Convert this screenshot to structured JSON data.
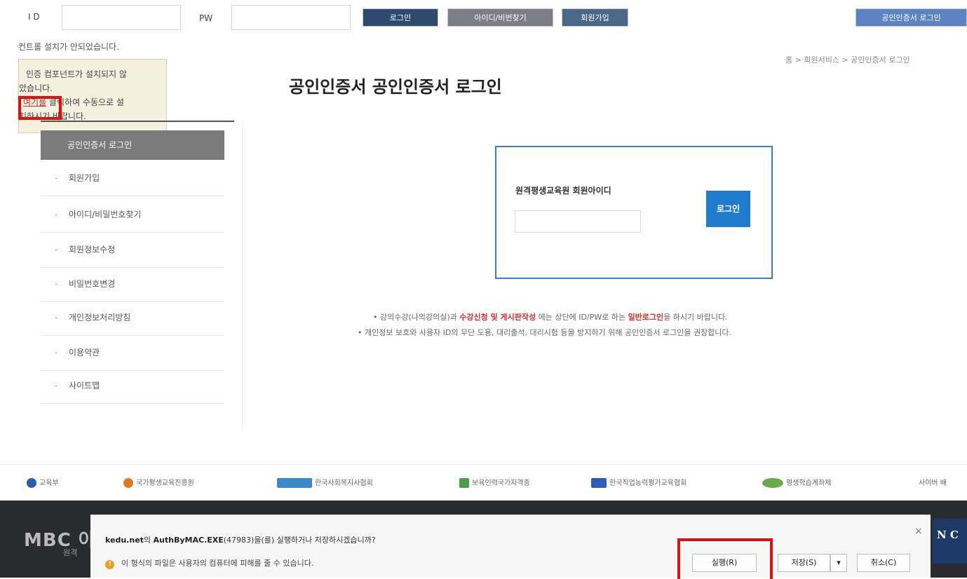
{
  "topbar": {
    "id_label": "I D",
    "pw_label": "PW",
    "login_button": "로그인",
    "find_button": "아이디/비번찾기",
    "join_button": "회원가입",
    "cert_login_button": "공인인증서 로그인"
  },
  "notice": {
    "top_text": "컨트롤 설치가 안되었습니다.",
    "line1": "인증 컴포넌트가 설치되지 않",
    "line2": "았습니다.",
    "link": "여기를",
    "line3": "클릭하여 수동으로 설",
    "line4": "치하시기 바랍니다."
  },
  "sidebar": {
    "active": "공인인증서 로그인",
    "items": [
      "회원가입",
      "아이디/비밀번호찾기",
      "회원정보수정",
      "비밀번호변경",
      "개인정보처리방침",
      "이용약관",
      "사이트맵"
    ]
  },
  "breadcrumb": "홈 > 회원서비스 > 공인인증서 로그인",
  "page_title": "공인인증서 공인인증서 로그인",
  "login_box": {
    "label": "원격평생교육원 회원아이디",
    "button": "로그인"
  },
  "notes": {
    "n1_a": "• 강의수강(나의강의실)과 ",
    "n1_b": "수강신청 및 게시판작성",
    "n1_c": " 에는 상단에 ID/PW로 하는 ",
    "n1_d": "일반로그인",
    "n1_e": "을 하시기 바랍니다.",
    "n2": "• 개인정보 보호와 사용자 ID의 무단 도용, 대리출석, 대리시험 등을 방지하기 위해 공인인증서 로그인을 권장합니다."
  },
  "partners": [
    "교육부",
    "국가평생교육진흥원",
    "한국사회복지사협회",
    "보육인력국가자격증",
    "한국직업능력평가교육협회",
    "평생학습계좌제",
    "사이버 배"
  ],
  "footer": {
    "logo": "MBC 아",
    "sub": "원격",
    "right": "N C"
  },
  "download": {
    "site": "kedu.net",
    "file": "AuthByMAC.EXE",
    "message_mid": "의 ",
    "message_tail": "(47983)을(를) 실행하거나 저장하시겠습니까?",
    "warning": "이 형식의 파일은 사용자의 컴퓨터에 피해를 줄 수 있습니다.",
    "run": "실행(R)",
    "save": "저장(S)",
    "cancel": "취소(C)",
    "close": "×"
  },
  "colors": {
    "accent": "#1f7bcb",
    "box_border": "#3d7fc2",
    "highlight": "#e01010"
  }
}
